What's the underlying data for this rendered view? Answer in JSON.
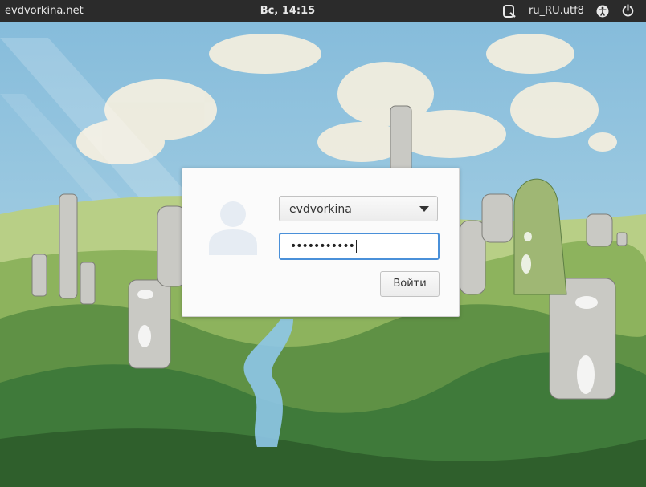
{
  "topbar": {
    "hostname": "evdvorkina.net",
    "clock": "Вс, 14:15",
    "locale": "ru_RU.utf8"
  },
  "icons": {
    "onboard": "onscreen-keyboard-icon",
    "accessibility": "accessibility-icon",
    "power": "power-icon",
    "avatar": "user-avatar-icon"
  },
  "login": {
    "selected_user": "evdvorkina",
    "password_masked": "•••••••••••",
    "submit_label": "Войти"
  },
  "colors": {
    "panel": "#2b2b2b",
    "focus": "#4a90d9"
  }
}
